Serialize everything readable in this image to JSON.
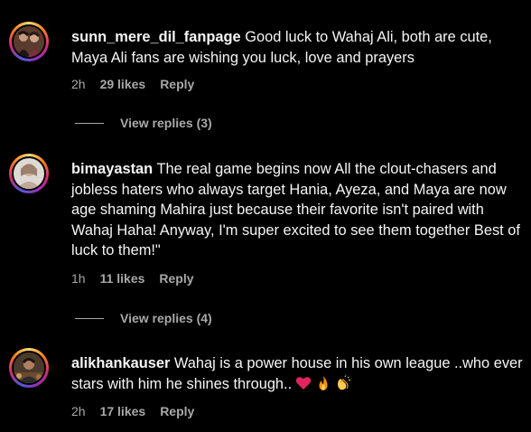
{
  "comments": [
    {
      "username": "sunn_mere_dil_fanpage",
      "text": "Good luck to Wahaj Ali, both are cute, Maya Ali fans are wishing you luck, love and prayers",
      "time": "2h",
      "likes": "29 likes",
      "reply": "Reply",
      "view_replies": "View replies (3)"
    },
    {
      "username": "bimayastan",
      "text": "The real game begins now All the clout-chasers and jobless haters who always target Hania, Ayeza, and Maya are now age shaming Mahira just because their favorite isn't paired with Wahaj Haha! Anyway, I'm super excited to see them together Best of luck to them!\"",
      "time": "1h",
      "likes": "11 likes",
      "reply": "Reply",
      "view_replies": "View replies (4)"
    },
    {
      "username": "alikhankauser",
      "text": "Wahaj is a power house in his own league ..who ever stars with him he shines through..",
      "emojis": [
        "heart-emoji",
        "fire-emoji",
        "clapping-hands-emoji"
      ],
      "time": "2h",
      "likes": "17 likes",
      "reply": "Reply"
    }
  ],
  "colors": {
    "background": "#000000",
    "text": "#f5f5f5",
    "secondary": "#a8a8a8"
  }
}
